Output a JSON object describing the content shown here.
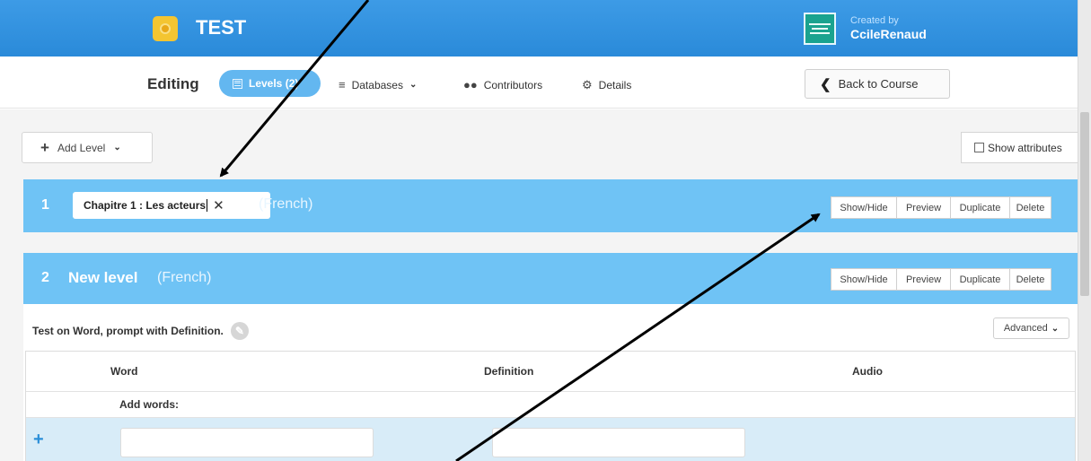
{
  "header": {
    "course_title": "TEST",
    "created_by_label": "Created by",
    "creator_name": "CcileRenaud"
  },
  "nav": {
    "editing_label": "Editing",
    "tabs": [
      {
        "label": "Levels (2)",
        "icon": "list-icon",
        "active": true
      },
      {
        "label": "Databases",
        "icon": "hamburger-icon"
      },
      {
        "label": "Contributors",
        "icon": "people-icon"
      },
      {
        "label": "Details",
        "icon": "gear-icon"
      }
    ],
    "back_label": "Back to Course"
  },
  "toolbar": {
    "add_level_label": "Add Level",
    "show_attributes_label": "Show attributes"
  },
  "levels": [
    {
      "number": "1",
      "name_value": "Chapitre 1 : Les acteurs",
      "language": "(French)",
      "buttons": [
        "Show/Hide",
        "Preview",
        "Duplicate",
        "Delete"
      ]
    },
    {
      "number": "2",
      "title": "New level",
      "language": "(French)",
      "buttons": [
        "Show/Hide",
        "Preview",
        "Duplicate",
        "Delete"
      ],
      "test_description": "Test on Word, prompt with Definition.",
      "advanced_label": "Advanced",
      "columns": [
        "Word",
        "Definition",
        "Audio"
      ],
      "add_words_label": "Add words:"
    }
  ],
  "colors": {
    "topbar": "#2f92df",
    "level_bar": "#6fc3f5",
    "active_tab": "#63b7f0",
    "input_row": "#d8ecf8"
  }
}
